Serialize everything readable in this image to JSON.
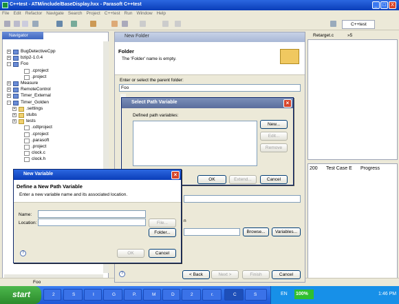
{
  "window": {
    "title": "C++test - ATM/include/BaseDisplay.hxx - Parasoft C++test",
    "controls": [
      "_",
      "□",
      "X"
    ]
  },
  "menu": [
    "File",
    "Edit",
    "Refactor",
    "Navigate",
    "Search",
    "Project",
    "C++test",
    "Run",
    "Window",
    "Help"
  ],
  "perspective_label": "C++test",
  "navigator": {
    "tab_label": "Navigator",
    "items": [
      {
        "label": "BugDetectiveCpp",
        "kind": "project",
        "expander": "+"
      },
      {
        "label": "bzip2-1.0.4",
        "kind": "project",
        "expander": "+"
      },
      {
        "label": "Foo",
        "kind": "project",
        "expander": "-"
      },
      {
        "label": ".cproject",
        "kind": "file",
        "expander": ""
      },
      {
        "label": ".project",
        "kind": "file",
        "expander": ""
      },
      {
        "label": "Measure",
        "kind": "project",
        "expander": "+"
      },
      {
        "label": "RemoteControl",
        "kind": "project",
        "expander": "+"
      },
      {
        "label": "Timer_External",
        "kind": "project",
        "expander": "+"
      },
      {
        "label": "Timer_Golden",
        "kind": "project",
        "expander": "-"
      },
      {
        "label": ".settings",
        "kind": "folder",
        "expander": "+"
      },
      {
        "label": "stubs",
        "kind": "folder",
        "expander": "+"
      },
      {
        "label": "tests",
        "kind": "folder",
        "expander": "+"
      },
      {
        "label": ".cdtproject",
        "kind": "file",
        "expander": ""
      },
      {
        "label": ".cproject",
        "kind": "file",
        "expander": ""
      },
      {
        "label": ".parasoft",
        "kind": "file",
        "expander": ""
      },
      {
        "label": ".project",
        "kind": "file",
        "expander": ""
      },
      {
        "label": "clock.c",
        "kind": "file",
        "expander": ""
      },
      {
        "label": "clock.h",
        "kind": "file",
        "expander": ""
      }
    ]
  },
  "editor": {
    "tab_label": "Retarget.c",
    "overflow_label": "»5"
  },
  "lower_panel": {
    "tabs": [
      "200",
      "Test Case E",
      "Progress"
    ]
  },
  "status_bar": {
    "text": "Foo"
  },
  "new_folder_dialog": {
    "title": "New Folder",
    "heading": "Folder",
    "message": "The 'Folder' name is empty.",
    "parent_label": "Enter or select the parent folder:",
    "parent_value": "Foo",
    "browse_label": "Browse...",
    "variables_label": "Variables...",
    "back_label": "< Back",
    "next_label": "Next >",
    "finish_label": "Finish",
    "cancel_label": "Cancel",
    "partial_text": "n"
  },
  "select_path_variable_dialog": {
    "title": "Select Path Variable",
    "list_label": "Defined path variables:",
    "new_label": "New...",
    "edit_label": "Edit...",
    "remove_label": "Remove",
    "ok_label": "OK",
    "extend_label": "Extend...",
    "cancel_label": "Cancel"
  },
  "new_variable_dialog": {
    "title": "New Variable",
    "heading": "Define a New Path Variable",
    "message": "Enter a new variable name and its associated location.",
    "name_label": "Name:",
    "name_value": "",
    "location_label": "Location:",
    "location_value": "",
    "file_label": "File...",
    "folder_label": "Folder...",
    "ok_label": "OK",
    "cancel_label": "Cancel"
  },
  "taskbar": {
    "start_label": "start",
    "tasks": [
      "2",
      "S",
      "I",
      "G",
      "P.",
      "M",
      "D",
      "2",
      "r.",
      "C",
      "S"
    ],
    "language": "EN",
    "battery": "100%",
    "clock": "1:46 PM"
  }
}
